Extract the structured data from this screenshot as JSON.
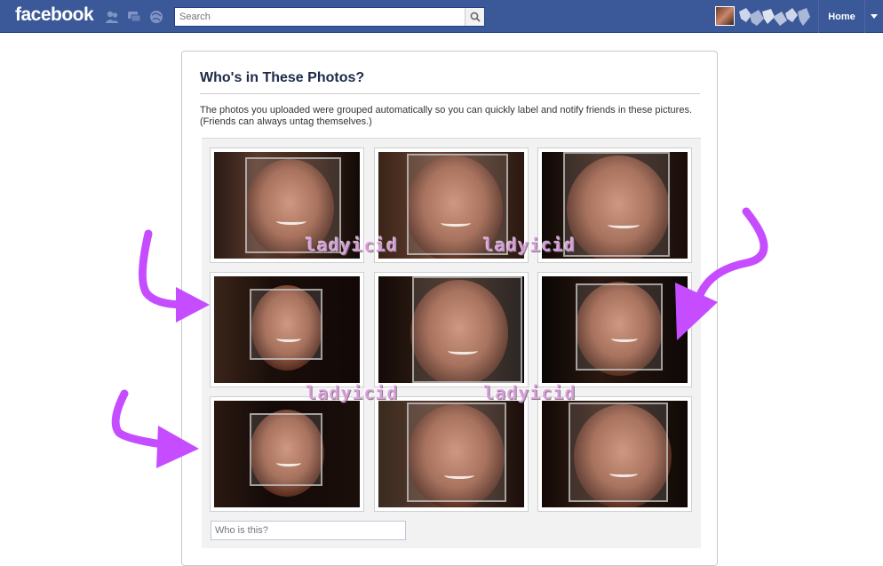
{
  "topbar": {
    "logo": "facebook",
    "search_placeholder": "Search",
    "home_label": "Home",
    "icons": [
      "friend-requests-icon",
      "messages-icon",
      "notifications-icon",
      "search-icon",
      "menu-caret-icon"
    ]
  },
  "dialog": {
    "title": "Who's in These Photos?",
    "description": "The photos you uploaded were grouped automatically so you can quickly label and notify friends in these pictures. (Friends can always untag themselves.)",
    "who_placeholder": "Who is this?",
    "photos": 9
  },
  "watermark": "ladyicid",
  "colors": {
    "brand_blue": "#3b5998",
    "arrow_purple": "#c64dff",
    "title_text": "#1c2a47"
  }
}
